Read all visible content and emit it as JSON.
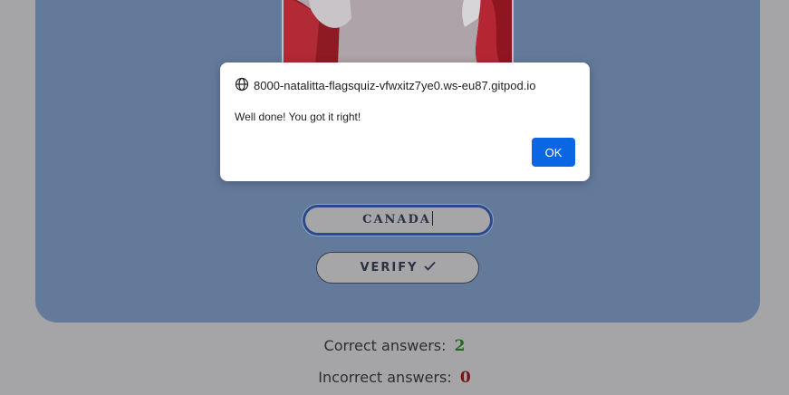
{
  "dialog": {
    "origin": "8000-natalitta-flagsquiz-vfwxitz7ye0.ws-eu87.gitpod.io",
    "origin_icon": "globe-icon",
    "message": "Well done! You got it right!",
    "ok_label": "OK"
  },
  "quiz": {
    "flag_icon": "canada-flag-image",
    "answer_value": "CANADA",
    "verify_label": "VERIFY",
    "verify_icon": "checkmark-icon"
  },
  "score": {
    "correct_label": "Correct answers:",
    "correct_value": "2",
    "incorrect_label": "Incorrect answers:",
    "incorrect_value": "0"
  },
  "colors": {
    "page_background": "#a5a5a7",
    "card_background": "#647a9b",
    "ok_button": "#0b66e4",
    "correct_value": "#1d6b1d",
    "incorrect_value": "#7a1010"
  }
}
